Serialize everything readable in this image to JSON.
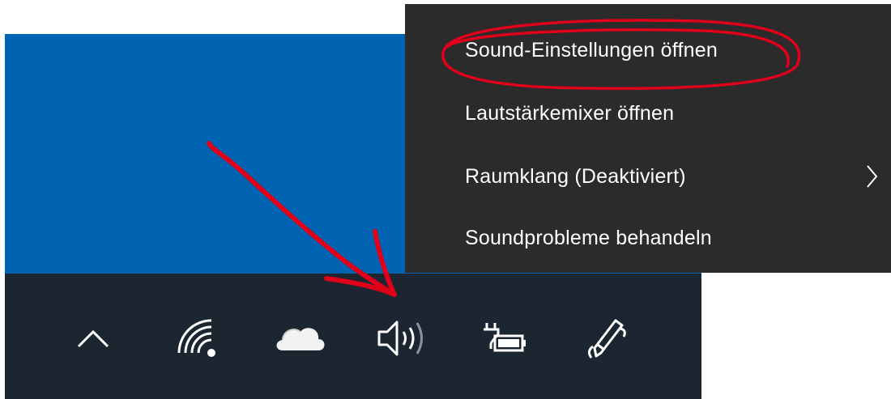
{
  "context_menu": {
    "items": [
      {
        "label": "Sound-Einstellungen öffnen",
        "has_submenu": false,
        "highlighted": true
      },
      {
        "label": "Lautstärkemixer öffnen",
        "has_submenu": false
      },
      {
        "label": "Raumklang (Deaktiviert)",
        "has_submenu": true
      },
      {
        "label": "Soundprobleme behandeln",
        "has_submenu": false
      }
    ],
    "colors": {
      "background": "#2b2b2b",
      "text": "#ffffff"
    }
  },
  "taskbar": {
    "tray_icons": [
      "show-hidden-icons-chevron-icon",
      "wifi-icon",
      "onedrive-cloud-icon",
      "volume-icon",
      "battery-charging-icon",
      "pen-workspace-icon"
    ],
    "colors": {
      "background": "#1b2630",
      "desktop": "#0063b1"
    }
  },
  "annotations": {
    "color": "#e0001a",
    "items": [
      "ellipse around Sound-Einstellungen öffnen",
      "arrow pointing to volume icon"
    ]
  }
}
